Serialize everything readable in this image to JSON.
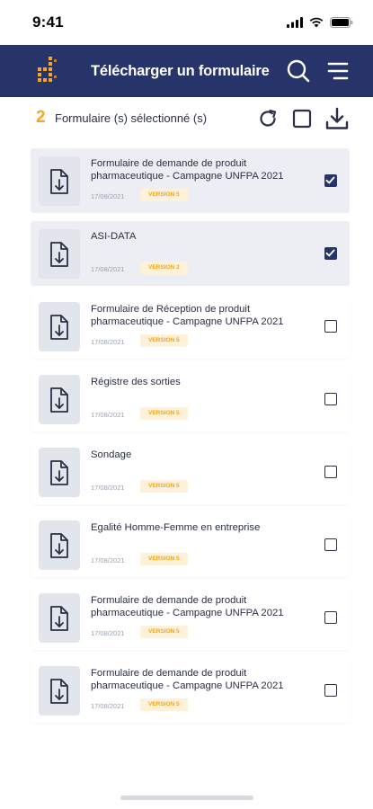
{
  "status_bar": {
    "time": "9:41"
  },
  "header": {
    "title": "Télécharger un formulaire"
  },
  "toolbar": {
    "selected_count": "2",
    "selected_label": "Formulaire (s) sélectionné (s)"
  },
  "colors": {
    "brand": "#27346a",
    "accent": "#f5a623",
    "selected_bg": "#eceef3"
  },
  "forms": [
    {
      "title": "Formulaire de demande de produit pharmaceutique - Campagne UNFPA 2021",
      "date": "17/08/2021",
      "version": "VERSION 5",
      "checked": true
    },
    {
      "title": "ASI-DATA",
      "date": "17/08/2021",
      "version": "VERSION 2",
      "checked": true
    },
    {
      "title": "Formulaire de Réception de produit pharmaceutique - Campagne UNFPA 2021",
      "date": "17/08/2021",
      "version": "VERSION 5",
      "checked": false
    },
    {
      "title": "Régistre des sorties",
      "date": "17/08/2021",
      "version": "VERSION 5",
      "checked": false
    },
    {
      "title": "Sondage",
      "date": "17/08/2021",
      "version": "VERSION 5",
      "checked": false
    },
    {
      "title": "Egalité Homme-Femme en entreprise",
      "date": "17/08/2021",
      "version": "VERSION 5",
      "checked": false
    },
    {
      "title": "Formulaire de demande de produit pharmaceutique - Campagne UNFPA 2021",
      "date": "17/08/2021",
      "version": "VERSION 5",
      "checked": false
    },
    {
      "title": "Formulaire de demande de produit pharmaceutique - Campagne UNFPA 2021",
      "date": "17/08/2021",
      "version": "VERSION 5",
      "checked": false
    }
  ]
}
